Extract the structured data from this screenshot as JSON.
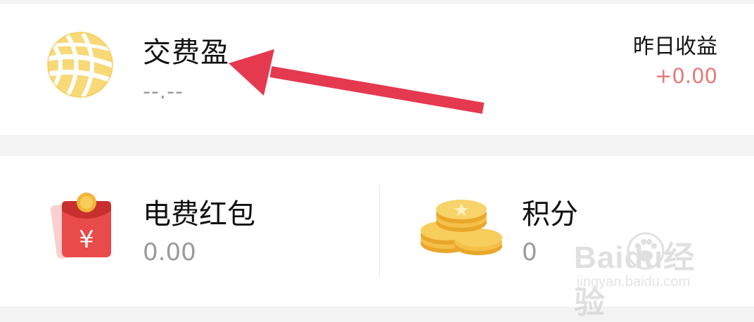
{
  "top_card": {
    "product_name": "交费盈",
    "value": "--.--",
    "yesterday_label": "昨日收益",
    "yesterday_value": "+0.00",
    "logo_icon": "globe-logo-icon"
  },
  "bottom_cards": {
    "left": {
      "title": "电费红包",
      "value": "0.00",
      "icon": "red-packet-icon"
    },
    "right": {
      "title": "积分",
      "value": "0",
      "icon": "gold-coins-icon"
    }
  },
  "watermark": {
    "main": "Baidu经验",
    "sub": "jingyan.baidu.com"
  },
  "colors": {
    "accent_red": "#e5394f",
    "gain_red": "#e47a7a",
    "logo_gold": "#f2c33a"
  }
}
